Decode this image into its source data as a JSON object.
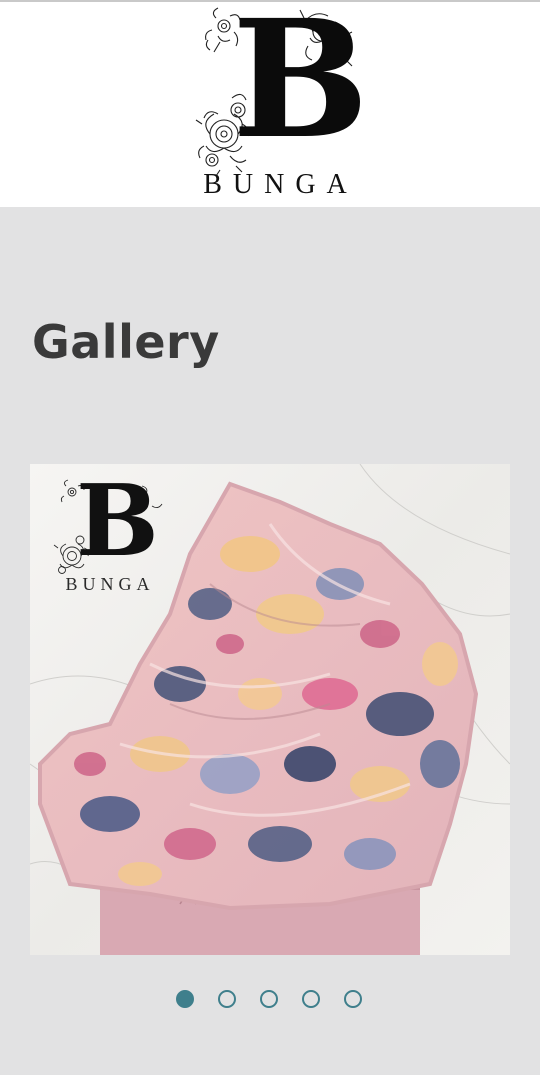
{
  "header": {
    "logo": {
      "letter": "B",
      "wordmark": "BUNGA"
    }
  },
  "gallery": {
    "title": "Gallery",
    "slide": {
      "logo": {
        "letter": "B",
        "wordmark": "BUNGA"
      }
    },
    "pagination": {
      "total": 5,
      "active_index": 0,
      "accent_color": "#3f7f8c"
    }
  }
}
